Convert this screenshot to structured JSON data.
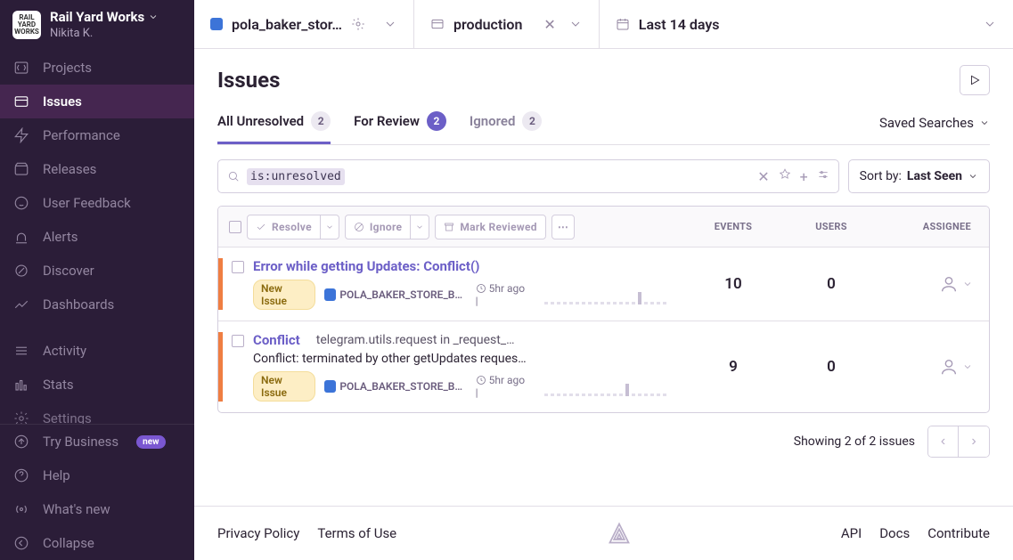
{
  "org": {
    "name": "Rail Yard Works",
    "user": "Nikita K.",
    "avatar_label": "RAIL YARD WORKS"
  },
  "sidebar": {
    "items": [
      {
        "label": "Projects"
      },
      {
        "label": "Issues"
      },
      {
        "label": "Performance"
      },
      {
        "label": "Releases"
      },
      {
        "label": "User Feedback"
      },
      {
        "label": "Alerts"
      },
      {
        "label": "Discover"
      },
      {
        "label": "Dashboards"
      }
    ],
    "secondary": [
      {
        "label": "Activity"
      },
      {
        "label": "Stats"
      },
      {
        "label": "Settings"
      }
    ],
    "footer": {
      "try_business": "Try Business",
      "new_badge": "new",
      "help": "Help",
      "whats_new": "What's new",
      "collapse": "Collapse"
    }
  },
  "topbar": {
    "project": "pola_baker_stor…",
    "environment": "production",
    "time_range": "Last 14 days"
  },
  "page": {
    "title": "Issues"
  },
  "tabs": {
    "all": {
      "label": "All Unresolved",
      "count": "2"
    },
    "review": {
      "label": "For Review",
      "count": "2"
    },
    "ignored": {
      "label": "Ignored",
      "count": "2"
    },
    "saved": "Saved Searches"
  },
  "search": {
    "prefix": "is:",
    "value": "unresolved",
    "sort_label": "Sort by:",
    "sort_value": "Last Seen"
  },
  "table": {
    "col_events": "EVENTS",
    "col_users": "USERS",
    "col_assignee": "ASSIGNEE",
    "btn_resolve": "Resolve",
    "btn_ignore": "Ignore",
    "btn_mark": "Mark Reviewed"
  },
  "issues": [
    {
      "title": "Error while getting Updates: Conflict()",
      "subtitle": "",
      "desc": "",
      "badge": "New Issue",
      "project": "POLA_BAKER_STORE_BO…",
      "age": "5hr ago",
      "events": "10",
      "users": "0"
    },
    {
      "title": "Conflict",
      "subtitle": "telegram.utils.request in _request_…",
      "desc": "Conflict: terminated by other getUpdates reques…",
      "badge": "New Issue",
      "project": "POLA_BAKER_STORE_BO…",
      "age": "5hr ago",
      "events": "9",
      "users": "0"
    }
  ],
  "pager": {
    "summary": "Showing 2 of 2 issues"
  },
  "footer": {
    "privacy": "Privacy Policy",
    "terms": "Terms of Use",
    "api": "API",
    "docs": "Docs",
    "contribute": "Contribute"
  }
}
